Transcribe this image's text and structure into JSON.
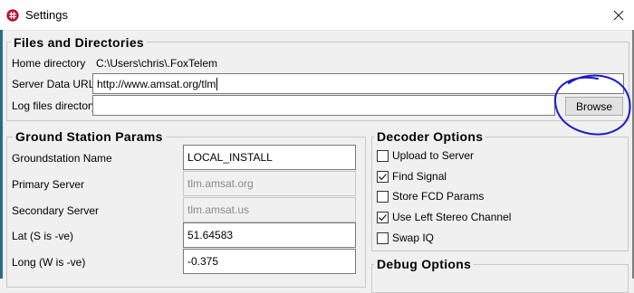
{
  "window": {
    "title": "Settings",
    "icon": "app-logo-icon",
    "close_icon": "close-icon"
  },
  "files_section": {
    "title": "Files and Directories",
    "home_label": "Home directory",
    "home_value": "C:\\Users\\chris\\.FoxTelem",
    "server_label": "Server Data URL",
    "server_value": "http://www.amsat.org/tlm",
    "log_label": "Log files directory",
    "log_value": "",
    "browse_label": "Browse"
  },
  "ground_section": {
    "title": "Ground Station Params",
    "fields": [
      {
        "label": "Groundstation Name",
        "value": "LOCAL_INSTALL",
        "enabled": true
      },
      {
        "label": "Primary Server",
        "value": "tlm.amsat.org",
        "enabled": false
      },
      {
        "label": "Secondary Server",
        "value": "tlm.amsat.us",
        "enabled": false
      },
      {
        "label": "Lat (S is -ve)",
        "value": "51.64583",
        "enabled": true
      },
      {
        "label": "Long (W is -ve)",
        "value": "-0.375",
        "enabled": true
      }
    ]
  },
  "decoder_section": {
    "title": "Decoder Options",
    "options": [
      {
        "label": "Upload to Server",
        "checked": false
      },
      {
        "label": "Find Signal",
        "checked": true
      },
      {
        "label": "Store FCD Params",
        "checked": false
      },
      {
        "label": "Use Left Stereo Channel",
        "checked": true
      },
      {
        "label": "Swap IQ",
        "checked": false
      }
    ]
  },
  "debug_section": {
    "title": "Debug Options"
  },
  "colors": {
    "annotation_ink": "#1a1acc",
    "accent_stripe": "#2b6a8c"
  }
}
